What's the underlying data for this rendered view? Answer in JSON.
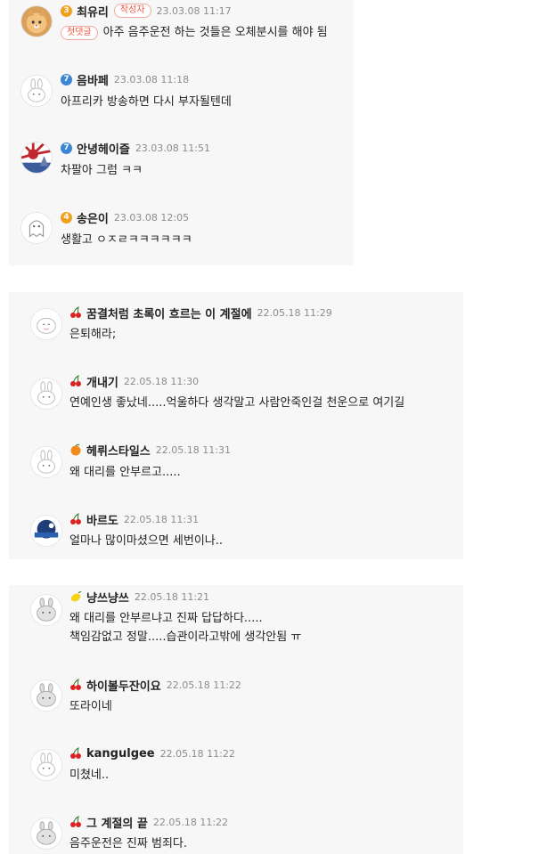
{
  "thread1": {
    "comments": [
      {
        "nick": "최유리",
        "level": "3",
        "level_color": "#f0a020",
        "badge": "작성자",
        "date": "23.03.08 11:17",
        "first_badge": "첫댓글",
        "text": "아주 음주운전 하는 것들은 오체분시를 해야 됨",
        "avatar": "cat-avatar-icon"
      },
      {
        "nick": "음바페",
        "level": "7",
        "level_color": "#3b87d6",
        "date": "23.03.08 11:18",
        "text": "아프리카 방송하면 다시 부자될텐데",
        "avatar": "default-bunny-avatar-icon"
      },
      {
        "nick": "안녕헤이즐",
        "level": "7",
        "level_color": "#3b87d6",
        "date": "23.03.08 11:51",
        "text": "차팔아 그럼 ㅋㅋ",
        "avatar": "rising-sun-avatar-icon"
      },
      {
        "nick": "송은이",
        "level": "4",
        "level_color": "#f0a020",
        "date": "23.03.08 12:05",
        "text": "생활고 ㅇㅈㄹㅋㅋㅋㅋㅋㅋ",
        "avatar": "ghost-avatar-icon"
      }
    ]
  },
  "thread2": {
    "comments": [
      {
        "nick": "꿈결처럼 초록이 흐르는 이 계절에",
        "fruit": "cherry-icon",
        "date": "22.05.18 11:29",
        "text": "은퇴해라;",
        "avatar": "smile-bunny-avatar-icon"
      },
      {
        "nick": "개내기",
        "fruit": "cherry-icon",
        "date": "22.05.18 11:30",
        "text": "연예인생 좋났네.....억울하다 생각말고 사람안죽인걸 천운으로 여기길",
        "avatar": "default-bunny-avatar-icon"
      },
      {
        "nick": "헤뤼스타일스",
        "fruit": "orange-icon",
        "date": "22.05.18 11:31",
        "text": "왜 대리를 안부르고.....",
        "avatar": "default-bunny-avatar-icon"
      },
      {
        "nick": "바르도",
        "fruit": "cherry-icon",
        "date": "22.05.18 11:31",
        "text": "얼마나 많이마셨으면 세번이나..",
        "avatar": "blue-logo-avatar-icon"
      }
    ]
  },
  "thread3": {
    "comments": [
      {
        "nick": "냥쓰냥쓰",
        "fruit": "lemon-icon",
        "date": "22.05.18 11:21",
        "lines": [
          "왜 대리를 안부르냐고 진짜 답답하다.....",
          "책임감없고 정말.....습관이라고밖에 생각안됨 ㅠ"
        ],
        "avatar": "gray-bunny-avatar-icon"
      },
      {
        "nick": "하이볼두잔이요",
        "fruit": "cherry-icon",
        "date": "22.05.18 11:22",
        "lines": [
          "또라이네"
        ],
        "avatar": "gray-bunny-avatar-icon"
      },
      {
        "nick": "kangulgee",
        "fruit": "cherry-icon",
        "date": "22.05.18 11:22",
        "lines": [
          "미쳤네.."
        ],
        "avatar": "default-bunny-avatar-icon"
      },
      {
        "nick": "그 계절의 끝",
        "fruit": "cherry-icon",
        "date": "22.05.18 11:22",
        "lines": [
          "음주운전은 진짜 범죄다."
        ],
        "avatar": "gray-bunny-avatar-icon"
      }
    ]
  }
}
